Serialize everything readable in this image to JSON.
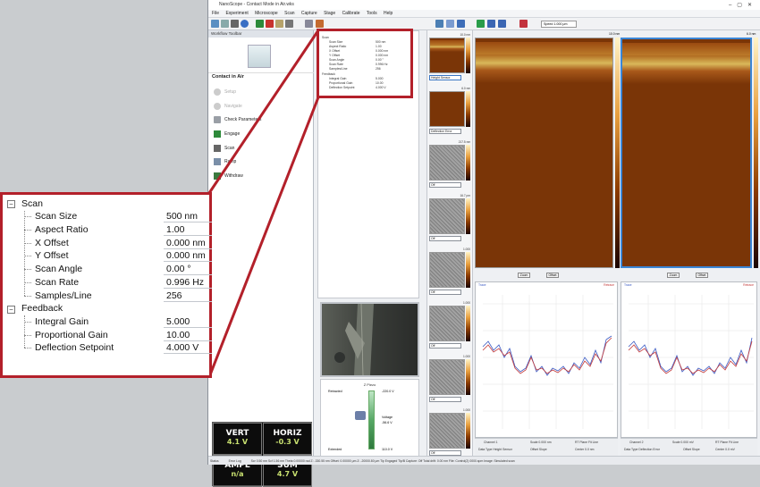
{
  "window": {
    "title": "NanoScope - Contact Mode in Air.wks",
    "menu": [
      "File",
      "Experiment",
      "Microscope",
      "Scan",
      "Capture",
      "Stage",
      "Calibrate",
      "Tools",
      "Help"
    ],
    "scan_speed_box": "Speed 1.000 μm"
  },
  "workflow": {
    "header": "Workflow Toolbar",
    "mode_title": "Contact in Air",
    "items": [
      {
        "label": "Setup",
        "enabled": false
      },
      {
        "label": "Navigate",
        "enabled": false
      },
      {
        "label": "Check Parameters",
        "enabled": true
      },
      {
        "label": "Engage",
        "enabled": true
      },
      {
        "label": "Scan",
        "enabled": true
      },
      {
        "label": "Ramp",
        "enabled": true
      },
      {
        "label": "Withdraw",
        "enabled": true
      }
    ]
  },
  "parameters": {
    "scan": {
      "label": "Scan",
      "rows": [
        {
          "name": "Scan Size",
          "value": "500 nm"
        },
        {
          "name": "Aspect Ratio",
          "value": "1.00"
        },
        {
          "name": "X Offset",
          "value": "0.000 nm"
        },
        {
          "name": "Y Offset",
          "value": "0.000 nm"
        },
        {
          "name": "Scan Angle",
          "value": "0.00 °"
        },
        {
          "name": "Scan Rate",
          "value": "0.996 Hz"
        },
        {
          "name": "Samples/Line",
          "value": "256"
        }
      ]
    },
    "feedback": {
      "label": "Feedback",
      "rows": [
        {
          "name": "Integral Gain",
          "value": "5.000"
        },
        {
          "name": "Proportional Gain",
          "value": "10.00"
        },
        {
          "name": "Deflection Setpoint",
          "value": "4.000 V"
        }
      ]
    }
  },
  "zpiezo": {
    "title": "Z Piezo",
    "retracted_label": "Retracted",
    "retracted_value": "-220.0 V",
    "voltage_label": "Voltage",
    "voltage_value": "-56.6 V",
    "extended_label": "Extended",
    "extended_value": "110.0 V"
  },
  "channels": [
    {
      "range": "10.0 nm",
      "mode": "Height Sensor",
      "image": "afm"
    },
    {
      "range": "6.0 nm",
      "mode": "Deflection Error",
      "image": "afm"
    },
    {
      "range": "217.5 nm",
      "mode": "Off",
      "image": "noise"
    },
    {
      "range": "16.7 pm",
      "mode": "Off",
      "image": "noise"
    },
    {
      "range": "1.000",
      "mode": "Off",
      "image": "noise"
    },
    {
      "range": "1.000",
      "mode": "Off",
      "image": "noise"
    },
    {
      "range": "1.000",
      "mode": "Off",
      "image": "noise"
    },
    {
      "range": "1.000",
      "mode": "Off",
      "image": "noise"
    }
  ],
  "image_panels": {
    "left_range": "10.0 nm",
    "right_range": "6.0 nm",
    "zoom_label": "Zoom",
    "offset_label": "Offset",
    "trace_label": "Trace",
    "retrace_label": "Retrace"
  },
  "meters": [
    {
      "label": "VERT",
      "value": "4.1 V"
    },
    {
      "label": "HORIZ",
      "value": "-0.3 V"
    },
    {
      "label": "AMPL",
      "value": "n/a"
    },
    {
      "label": "SUM",
      "value": "4.7 V"
    }
  ],
  "statusbar": {
    "tabs": [
      "Status",
      "Error Log"
    ],
    "text": "Scr 0.50 nm   Scf 1.56 nm   Theta 0.00000 rad   Z: -330.55 nm   Offset: 0.00000 μm   Z: -20000.80 μm   Tip Engaged   Tip/B   Capture: Off   Total drift: 0.00 nm   File: Control(2) 0000.spm   Image: Simulated scan"
  },
  "plot_controls": {
    "left": [
      "Channel 1",
      "Scale 0.000 nm",
      "RT Plane Fit Line",
      "Data Type Height Sensor",
      "Offset Slope",
      "Center 0.0 nm"
    ],
    "right": [
      "Channel 2",
      "Scale 0.000 mV",
      "RT Plane Fit Line",
      "Data Type Deflection Error",
      "Offset Slope",
      "Center 0.0 mV"
    ]
  }
}
